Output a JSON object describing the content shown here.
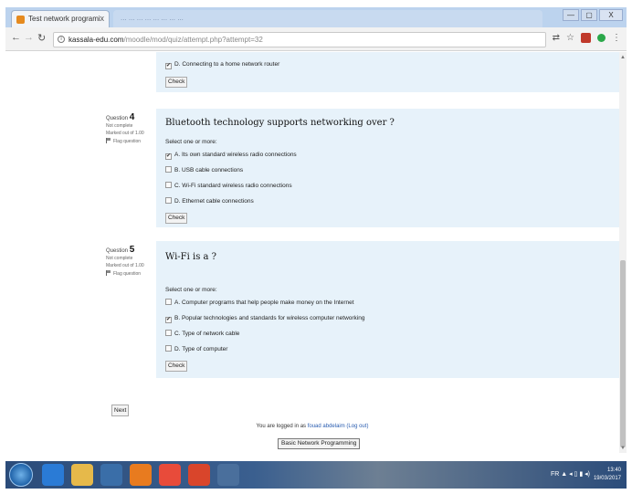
{
  "browser": {
    "tab_title": "Test network programi",
    "tab_close": "x",
    "inactive_tab_text": "... ... ... ... ... ... ... ...",
    "window_controls": [
      "—",
      "▢",
      "X"
    ],
    "url_host": "kassala-edu.com",
    "url_path": "/moodle/mod/quiz/attempt.php?attempt=32"
  },
  "page": {
    "prev_option": {
      "letter": "D.",
      "text": "Connecting to a home network router",
      "checked": true
    },
    "check_label": "Check",
    "questions": [
      {
        "number_label": "Question",
        "number": "4",
        "status": "Not complete",
        "marked": "Marked out of 1.00",
        "flag": "Flag question",
        "text": "Bluetooth technology supports networking over ?",
        "prompt": "Select one or more:",
        "options": [
          {
            "text": "A. Its own standard wireless radio connections",
            "checked": true
          },
          {
            "text": "B. USB cable connections",
            "checked": false
          },
          {
            "text": "C. Wi-Fi standard wireless radio connections",
            "checked": false
          },
          {
            "text": "D. Ethernet cable connections",
            "checked": false
          }
        ]
      },
      {
        "number_label": "Question",
        "number": "5",
        "status": "Not complete",
        "marked": "Marked out of 1.00",
        "flag": "Flag question",
        "text": "Wi-Fi is a ?",
        "prompt": "Select one or more:",
        "options": [
          {
            "text": "A. Computer programs that help people make money on the Internet",
            "checked": false
          },
          {
            "text": "B. Popular technologies and standards for wireless computer networking",
            "checked": true
          },
          {
            "text": "C. Type of network cable",
            "checked": false
          },
          {
            "text": "D. Type of computer",
            "checked": false
          }
        ]
      }
    ],
    "next_label": "Next",
    "logged_in_prefix": "You are logged in as",
    "user_name": "fouad abdelaim",
    "logout": "(Log out)",
    "course_button": "Basic Network Programming"
  },
  "taskbar": {
    "tray_text": "FR ▲ ◂ ▯ ▮ ◂)",
    "time": "13:40",
    "date": "19/03/2017"
  },
  "colors": {
    "question_bg": "#e7f2fa",
    "link": "#2a5db0"
  }
}
